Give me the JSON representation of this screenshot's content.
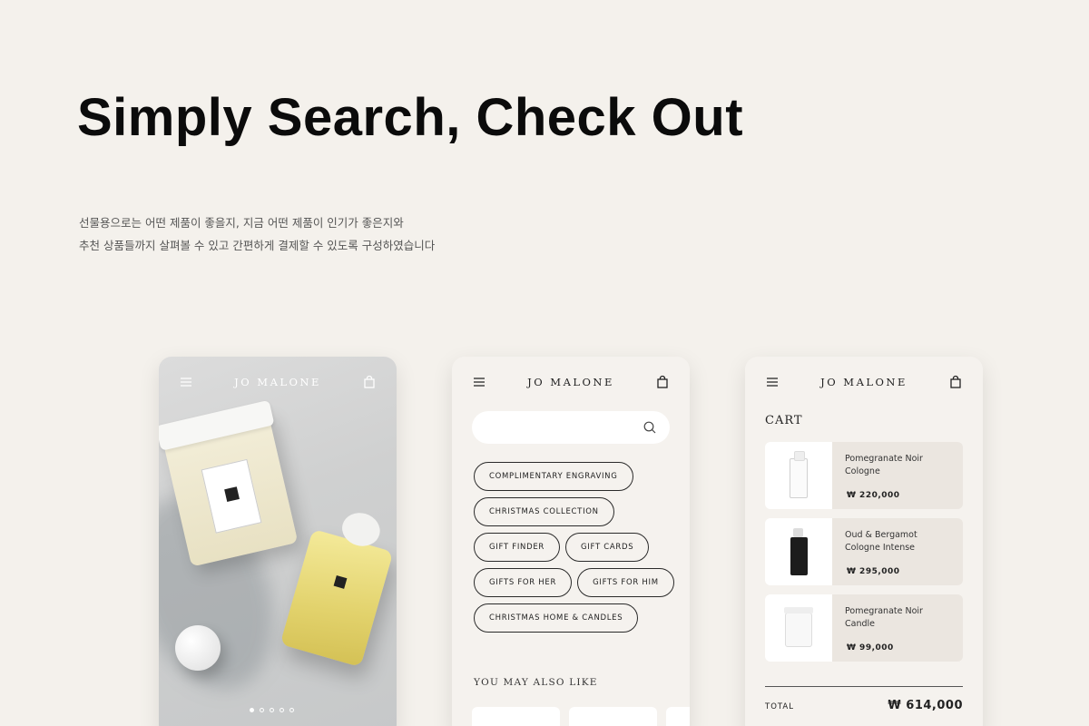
{
  "headline": "Simply Search, Check Out",
  "description": [
    "선물용으로는 어떤 제품이 좋을지, 지금 어떤 제품이 인기가 좋은지와",
    "추천 상품들까지 살펴볼 수 있고 간편하게 결제할 수 있도록 구성하였습니다"
  ],
  "brand": "JO MALONE",
  "icons": {
    "menu": "hamburger-menu-icon",
    "bag": "shopping-bag-icon",
    "search": "search-icon"
  },
  "phone1": {
    "carousel_dots": 5,
    "active_dot": 0
  },
  "phone2": {
    "search_placeholder": "",
    "chips": [
      "COMPLIMENTARY ENGRAVING",
      "CHRISTMAS COLLECTION",
      "GIFT FINDER",
      "GIFT CARDS",
      "GIFTS FOR HER",
      "GIFTS FOR HIM",
      "CHRISTMAS HOME & CANDLES"
    ],
    "section_title": "YOU MAY ALSO LIKE"
  },
  "phone3": {
    "title": "CART",
    "items": [
      {
        "name": "Pomegranate Noir Cologne",
        "price": "₩ 220,000"
      },
      {
        "name": "Oud & Bergamot Cologne Intense",
        "price": "₩ 295,000"
      },
      {
        "name": "Pomegranate Noir Candle",
        "price": "₩ 99,000"
      }
    ],
    "total_label": "TOTAL",
    "total_value": "₩ 614,000"
  },
  "colors": {
    "background": "#f4f1ec",
    "card": "#f5f2ee",
    "item_bg": "#ebe6e0",
    "text": "#1a1a1a"
  }
}
